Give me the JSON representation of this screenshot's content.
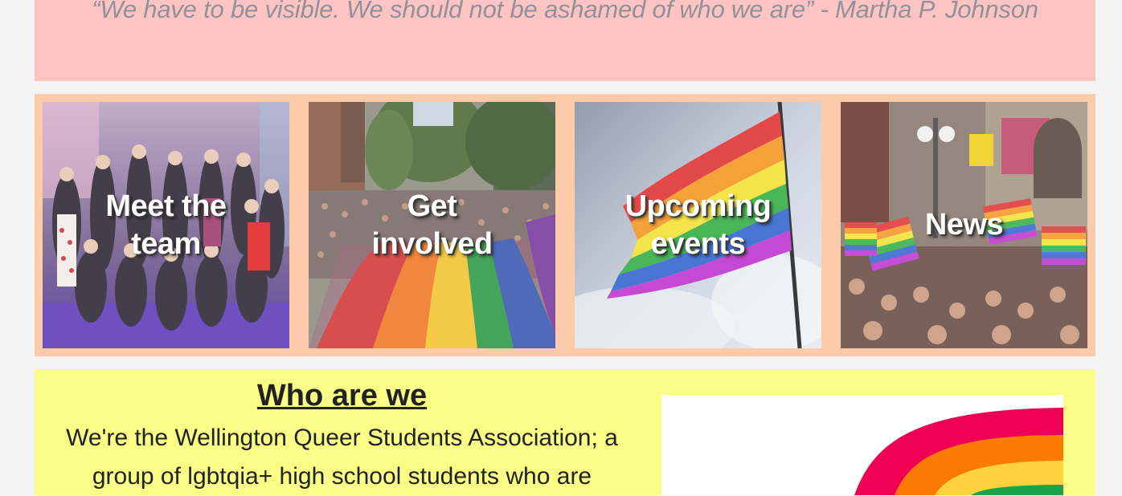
{
  "quote": {
    "text": "“We have to be visible. We should not be ashamed of who we are” - Martha P. Johnson"
  },
  "tiles": [
    {
      "label_line1": "Meet the",
      "label_line2": "team",
      "image": "group-photo"
    },
    {
      "label_line1": "Get",
      "label_line2": "involved",
      "image": "pride-parade-rainbow-flag"
    },
    {
      "label_line1": "Upcoming",
      "label_line2": "events",
      "image": "rainbow-flag-sky"
    },
    {
      "label_line1": "News",
      "label_line2": "",
      "image": "crowd-with-flags"
    }
  ],
  "who": {
    "title": "Who are we",
    "body": "We're the Wellington Queer Students Association; a group of lgbtqia+ high school students who are"
  },
  "colors": {
    "quote_band": "#fec3c3",
    "tiles_band": "#fdcaaa",
    "who_band": "#fafd86",
    "rainbow": [
      "#ee0052",
      "#fb7a02",
      "#fdd23d",
      "#19a44a"
    ]
  }
}
